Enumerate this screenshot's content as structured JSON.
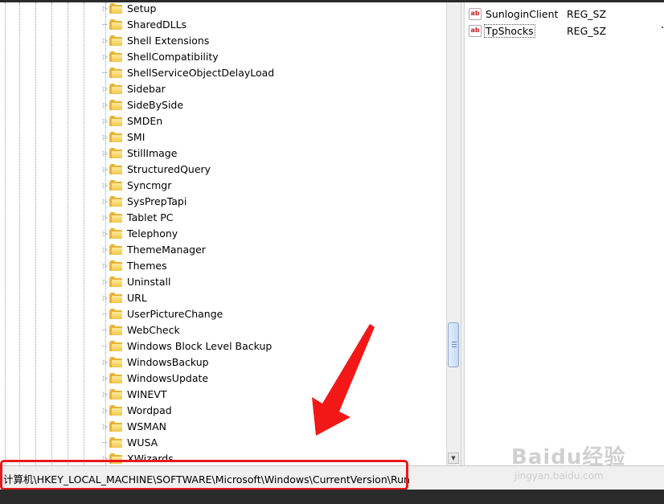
{
  "tree": {
    "items": [
      {
        "label": "Setup",
        "expandable": true
      },
      {
        "label": "SharedDLLs",
        "expandable": false
      },
      {
        "label": "Shell Extensions",
        "expandable": true
      },
      {
        "label": "ShellCompatibility",
        "expandable": true
      },
      {
        "label": "ShellServiceObjectDelayLoad",
        "expandable": false
      },
      {
        "label": "Sidebar",
        "expandable": true
      },
      {
        "label": "SideBySide",
        "expandable": true
      },
      {
        "label": "SMDEn",
        "expandable": true
      },
      {
        "label": "SMI",
        "expandable": true
      },
      {
        "label": "StillImage",
        "expandable": true
      },
      {
        "label": "StructuredQuery",
        "expandable": true
      },
      {
        "label": "Syncmgr",
        "expandable": true
      },
      {
        "label": "SysPrepTapi",
        "expandable": true
      },
      {
        "label": "Tablet PC",
        "expandable": true
      },
      {
        "label": "Telephony",
        "expandable": true
      },
      {
        "label": "ThemeManager",
        "expandable": true
      },
      {
        "label": "Themes",
        "expandable": true
      },
      {
        "label": "Uninstall",
        "expandable": true
      },
      {
        "label": "URL",
        "expandable": true
      },
      {
        "label": "UserPictureChange",
        "expandable": false
      },
      {
        "label": "WebCheck",
        "expandable": false
      },
      {
        "label": "Windows Block Level Backup",
        "expandable": false
      },
      {
        "label": "WindowsBackup",
        "expandable": true
      },
      {
        "label": "WindowsUpdate",
        "expandable": true
      },
      {
        "label": "WINEVT",
        "expandable": true
      },
      {
        "label": "Wordpad",
        "expandable": true
      },
      {
        "label": "WSMAN",
        "expandable": true
      },
      {
        "label": "WUSA",
        "expandable": false
      },
      {
        "label": "XWizards",
        "expandable": true
      }
    ]
  },
  "values": {
    "rows": [
      {
        "name": "SunloginClient",
        "type": "REG_SZ",
        "icon": "ab-string-icon"
      },
      {
        "name": "TpShocks",
        "type": "REG_SZ",
        "icon": "ab-string-icon"
      }
    ]
  },
  "status_bar": {
    "path": "计算机\\HKEY_LOCAL_MACHINE\\SOFTWARE\\Microsoft\\Windows\\CurrentVersion\\Run"
  },
  "watermark": {
    "main": "Baidu经验",
    "sub": "jingyan.baidu.com"
  },
  "colors": {
    "highlight": "#e8191b",
    "folder": "#e6b43a",
    "status_bg": "#f0f0f0"
  }
}
